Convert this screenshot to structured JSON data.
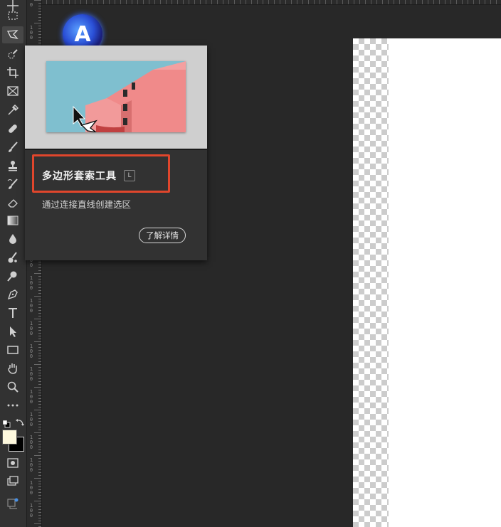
{
  "tooltip": {
    "title": "多边形套索工具",
    "shortcut": "L",
    "description": "通过连接直线创建选区",
    "learn_more_label": "了解详情"
  },
  "logo": {
    "glyph": "A"
  },
  "toolbar": {
    "tools": [
      "move-tool",
      "rectangular-marquee-tool",
      "polygonal-lasso-tool",
      "quick-selection-tool",
      "crop-tool",
      "frame-tool",
      "eyedropper-tool",
      "spot-healing-tool",
      "brush-tool",
      "clone-stamp-tool",
      "history-brush-tool",
      "eraser-tool",
      "gradient-tool",
      "blur-tool",
      "smudge-tool",
      "dodge-tool",
      "pen-tool",
      "type-tool",
      "path-selection-tool",
      "rectangle-tool",
      "hand-tool",
      "zoom-tool",
      "more-tools"
    ],
    "foreground_color": "#fdf8dd",
    "background_color": "#000000"
  },
  "ruler": {
    "labels": [
      "0",
      "100",
      "100",
      "100",
      "100",
      "100",
      "100",
      "100",
      "100",
      "100",
      "100",
      "100",
      "100",
      "100",
      "100",
      "100",
      "100",
      "100",
      "100",
      "100",
      "100",
      "100",
      "100"
    ]
  },
  "colors": {
    "highlight": "#e0462c",
    "panel": "#323232",
    "workspace": "#282828"
  }
}
